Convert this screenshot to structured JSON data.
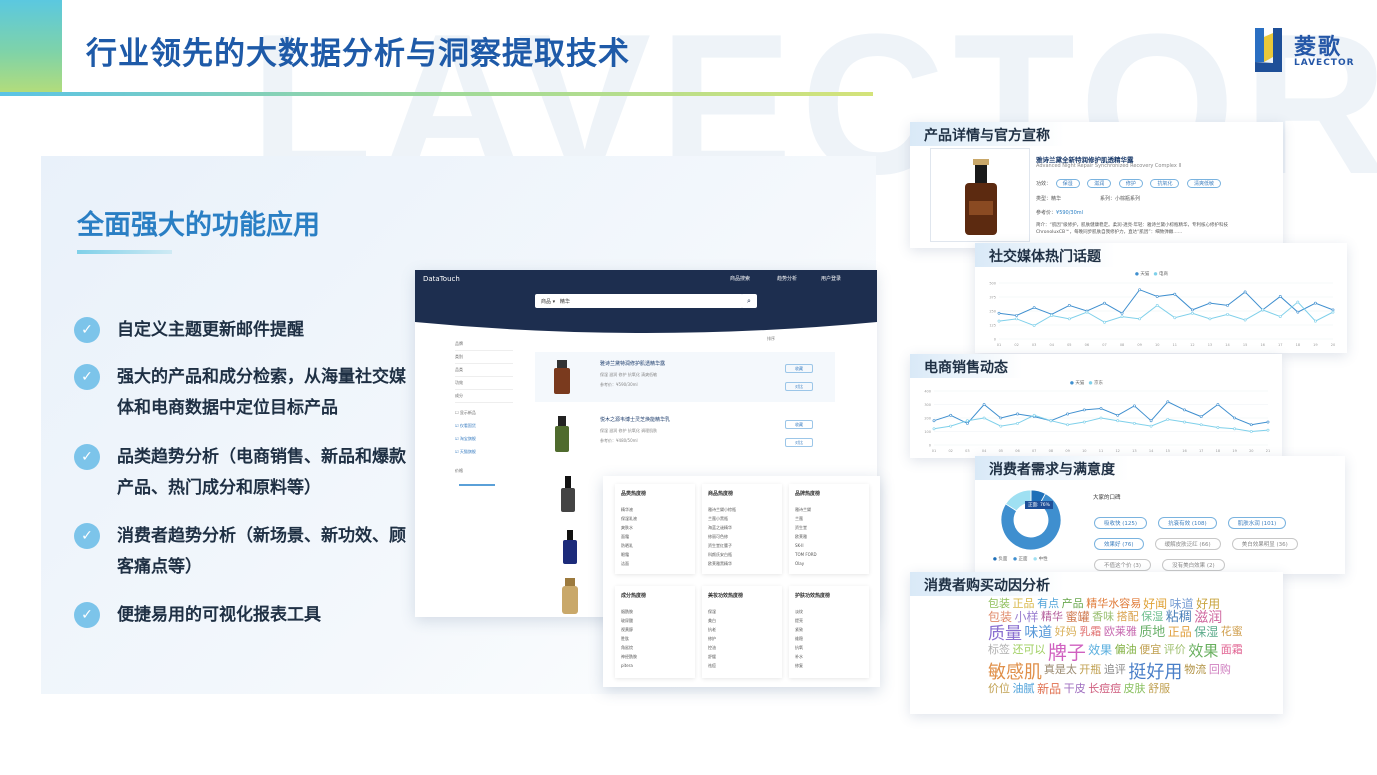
{
  "slide": {
    "title": "行业领先的大数据分析与洞察提取技术",
    "watermark": "LAVECTOR",
    "logo": {
      "cn": "菱歌",
      "en": "LAVECTOR"
    }
  },
  "section": {
    "title": "全面强大的功能应用",
    "features": [
      "自定义主题更新邮件提醒",
      "强大的产品和成分检索，从海量社交媒体和电商数据中定位目标产品",
      "品类趋势分析（电商销售、新品和爆款产品、热门成分和原料等）",
      "消费者趋势分析（新场景、新功效、顾客痛点等）",
      "便捷易用的可视化报表工具"
    ]
  },
  "app": {
    "brand": "DataTouch",
    "nav": [
      "商品搜索",
      "趋势分析",
      "用户登录"
    ],
    "search_category": "商品",
    "search_value": "精华",
    "filters": [
      "品牌",
      "类别",
      "品类",
      "功效",
      "成分"
    ],
    "checkboxes": [
      "显示新品",
      "仅看国货",
      "淘宝旗舰",
      "天猫旗舰"
    ],
    "price_label": "价格",
    "sort_label": "排序",
    "products": [
      {
        "name": "雅诗兰黛特润修护肌透精华露",
        "tags": "保湿  滋润  修护  抗氧化  清爽低敏",
        "price": "参考价：¥590/30ml",
        "btn1": "收藏",
        "btn2": "对比"
      },
      {
        "name": "悦木之源韦博士灵芝焕能精华乳",
        "tags": "保湿  滋润  修护  抗氧化  调理肌肤",
        "price": "参考价：¥480/50ml",
        "btn1": "收藏",
        "btn2": "对比"
      }
    ],
    "popup_cards": [
      {
        "title": "品类热度榜",
        "items": [
          "精华液",
          "保湿乳液",
          "爽肤水",
          "面霜",
          "防晒乳",
          "眼霜",
          "洁面"
        ]
      },
      {
        "title": "商品热度榜",
        "items": [
          "雅诗兰黛小棕瓶",
          "兰蔻小黑瓶",
          "海蓝之谜精华",
          "修丽可色修",
          "资生堂红腰子",
          "科颜氏安白瓶",
          "欧莱雅黑精华"
        ]
      },
      {
        "title": "品牌热度榜",
        "items": [
          "雅诗兰黛",
          "兰蔻",
          "资生堂",
          "欧莱雅",
          "SK-II",
          "TOM FORD",
          "Olay"
        ]
      },
      {
        "title": "成分热度榜",
        "items": [
          "烟酰胺",
          "玻尿酸",
          "视黄醇",
          "胜肽",
          "角鲨烷",
          "神经酰胺",
          "pitera"
        ]
      },
      {
        "title": "美妆功效热度榜",
        "items": [
          "保湿",
          "美白",
          "抗老",
          "修护",
          "控油",
          "舒缓",
          "祛痘"
        ]
      },
      {
        "title": "护肤功效热度榜",
        "items": [
          "淡纹",
          "提亮",
          "紧致",
          "维稳",
          "抗氧",
          "补水",
          "修复"
        ]
      }
    ]
  },
  "cards": {
    "product": {
      "title": "产品详情与官方宣称",
      "name": "雅诗兰黛全新特润修护肌透精华露",
      "en_name": "Advanced Night Repair Synchronized Recovery Complex II",
      "func_label": "功效：",
      "func_tags": [
        "保湿",
        "滋润",
        "修护",
        "抗氧化",
        "清爽低敏"
      ],
      "type_label": "类型：",
      "type_value": "精华",
      "series_label": "系列：",
      "series_value": "小棕瓶系列",
      "price_label": "参考价：",
      "price_value": "¥590/30ml",
      "desc": "简介：“肌因”级修护，肌肤健康稳定。柔润·透亮·年轻：雅诗兰黛小棕瓶精华，专利核心修护科技ChronoluxCB™，每晚同步肌肤自我修护力，直达“肌因”：细致弹嫩……"
    },
    "social": {
      "title": "社交媒体热门话题",
      "legend": [
        "天猫",
        "电商"
      ]
    },
    "ecommerce": {
      "title": "电商销售动态",
      "legend": [
        "天猫",
        "京东"
      ]
    },
    "consumer": {
      "title": "消费者需求与满意度",
      "legend": [
        "负面",
        "正面",
        "中性"
      ],
      "donut_label": "正面: 76%",
      "voice_title": "大家的口碑",
      "tags": [
        "吸收快 (125)",
        "抗衰有效 (108)",
        "肌肤水润 (101)",
        "效果好 (76)",
        "缓解皮肤泛红 (66)",
        "美白效果明显 (36)",
        "不值这个价 (3)",
        "没有美白效果 (2)"
      ]
    },
    "purchase": {
      "title": "消费者购买动因分析"
    }
  },
  "chart_data": [
    {
      "type": "line",
      "title": "社交媒体热门话题",
      "x": [
        "01",
        "02",
        "03",
        "04",
        "05",
        "06",
        "07",
        "08",
        "09",
        "10",
        "11",
        "12",
        "13",
        "14",
        "15",
        "16",
        "17",
        "18",
        "19",
        "20"
      ],
      "series": [
        {
          "name": "天猫",
          "values": [
            230,
            210,
            280,
            220,
            300,
            250,
            320,
            230,
            440,
            380,
            400,
            260,
            320,
            300,
            420,
            260,
            380,
            240,
            320,
            260
          ]
        },
        {
          "name": "电商",
          "values": [
            160,
            180,
            120,
            210,
            180,
            240,
            150,
            200,
            180,
            300,
            190,
            230,
            180,
            220,
            170,
            260,
            200,
            330,
            160,
            240
          ]
        }
      ],
      "ylim": [
        0,
        500
      ]
    },
    {
      "type": "line",
      "title": "电商销售动态",
      "x": [
        "01",
        "02",
        "03",
        "04",
        "05",
        "06",
        "07",
        "08",
        "09",
        "10",
        "11",
        "12",
        "13",
        "14",
        "15",
        "16",
        "17",
        "18",
        "19",
        "20",
        "21"
      ],
      "series": [
        {
          "name": "天猫",
          "values": [
            180,
            220,
            160,
            300,
            200,
            230,
            210,
            180,
            230,
            260,
            270,
            220,
            290,
            180,
            320,
            260,
            210,
            300,
            200,
            150,
            170
          ]
        },
        {
          "name": "京东",
          "values": [
            120,
            140,
            180,
            200,
            140,
            160,
            220,
            180,
            150,
            170,
            200,
            180,
            160,
            140,
            190,
            170,
            150,
            130,
            120,
            100,
            110
          ]
        }
      ],
      "ylim": [
        0,
        400
      ]
    },
    {
      "type": "pie",
      "title": "消费者需求与满意度",
      "categories": [
        "负面",
        "正面",
        "中性"
      ],
      "values": [
        8,
        76,
        16
      ]
    }
  ],
  "wordcloud": [
    {
      "t": "包装",
      "c": "#8fbf5a",
      "s": 11
    },
    {
      "t": "正品",
      "c": "#d9b84a",
      "s": 11
    },
    {
      "t": "有点",
      "c": "#4fa3d9",
      "s": 11
    },
    {
      "t": "产品",
      "c": "#6aa84f",
      "s": 11
    },
    {
      "t": "精华水容易",
      "c": "#e07b39",
      "s": 11
    },
    {
      "t": "好闻",
      "c": "#e0a43a",
      "s": 12
    },
    {
      "t": "味道",
      "c": "#7a9fd4",
      "s": 12
    },
    {
      "t": "好用",
      "c": "#c9a540",
      "s": 12
    },
    {
      "t": "包装",
      "c": "#e08a6a",
      "s": 12
    },
    {
      "t": "小样",
      "c": "#9a7fd0",
      "s": 12
    },
    {
      "t": "精华",
      "c": "#b35c9a",
      "s": 11
    },
    {
      "t": "蜜罐",
      "c": "#d07a50",
      "s": 12
    },
    {
      "t": "香味",
      "c": "#9abf70",
      "s": 11
    },
    {
      "t": "搭配",
      "c": "#d9a14a",
      "s": 11
    },
    {
      "t": "保湿",
      "c": "#6fbf8f",
      "s": 11
    },
    {
      "t": "粘稠",
      "c": "#4a7fb8",
      "s": 13
    },
    {
      "t": "滋润",
      "c": "#d06aa0",
      "s": 14
    },
    {
      "t": "质量",
      "c": "#8a6fd0",
      "s": 17
    },
    {
      "t": "味道",
      "c": "#5a9ad9",
      "s": 14
    },
    {
      "t": "好妈",
      "c": "#d9b05a",
      "s": 11
    },
    {
      "t": "乳霜",
      "c": "#e07070",
      "s": 11
    },
    {
      "t": "欧莱雅",
      "c": "#c76ab0",
      "s": 11
    },
    {
      "t": "质地",
      "c": "#6ab06a",
      "s": 13
    },
    {
      "t": "正品",
      "c": "#e0a040",
      "s": 12
    },
    {
      "t": "保湿",
      "c": "#5aaa8a",
      "s": 12
    },
    {
      "t": "花蜜",
      "c": "#d0a050",
      "s": 11
    },
    {
      "t": "标签",
      "c": "#b0b0b0",
      "s": 11
    },
    {
      "t": "还可以",
      "c": "#9fcf60",
      "s": 11
    },
    {
      "t": "牌子",
      "c": "#d060c0",
      "s": 19
    },
    {
      "t": "效果",
      "c": "#5aafdf",
      "s": 12
    },
    {
      "t": "偏油",
      "c": "#80b040",
      "s": 11
    },
    {
      "t": "便宜",
      "c": "#c0a050",
      "s": 11
    },
    {
      "t": "评价",
      "c": "#a0c070",
      "s": 11
    },
    {
      "t": "效果",
      "c": "#6ab060",
      "s": 15
    },
    {
      "t": "面霜",
      "c": "#e06090",
      "s": 11
    },
    {
      "t": "敏感肌",
      "c": "#e0904a",
      "s": 18
    },
    {
      "t": "真是太",
      "c": "#9a8a70",
      "s": 11
    },
    {
      "t": "开瓶",
      "c": "#c0a050",
      "s": 11
    },
    {
      "t": "追评",
      "c": "#8a8a8a",
      "s": 11
    },
    {
      "t": "挺好用",
      "c": "#4a7fc8",
      "s": 18
    },
    {
      "t": "物流",
      "c": "#b09040",
      "s": 11
    },
    {
      "t": "回购",
      "c": "#d080c0",
      "s": 11
    },
    {
      "t": "价位",
      "c": "#c0a050",
      "s": 11
    },
    {
      "t": "油腻",
      "c": "#4a9fd9",
      "s": 11
    },
    {
      "t": "新品",
      "c": "#e07050",
      "s": 12
    },
    {
      "t": "干皮",
      "c": "#a070c0",
      "s": 11
    },
    {
      "t": "长痘痘",
      "c": "#d06080",
      "s": 11
    },
    {
      "t": "皮肤",
      "c": "#8ac060",
      "s": 11
    },
    {
      "t": "舒服",
      "c": "#c0a050",
      "s": 11
    }
  ],
  "colors": {
    "brand": "#1e5aa8",
    "accent": "#2a7fc4",
    "line_dark": "#3f8fcf",
    "line_light": "#7fd0ea"
  }
}
